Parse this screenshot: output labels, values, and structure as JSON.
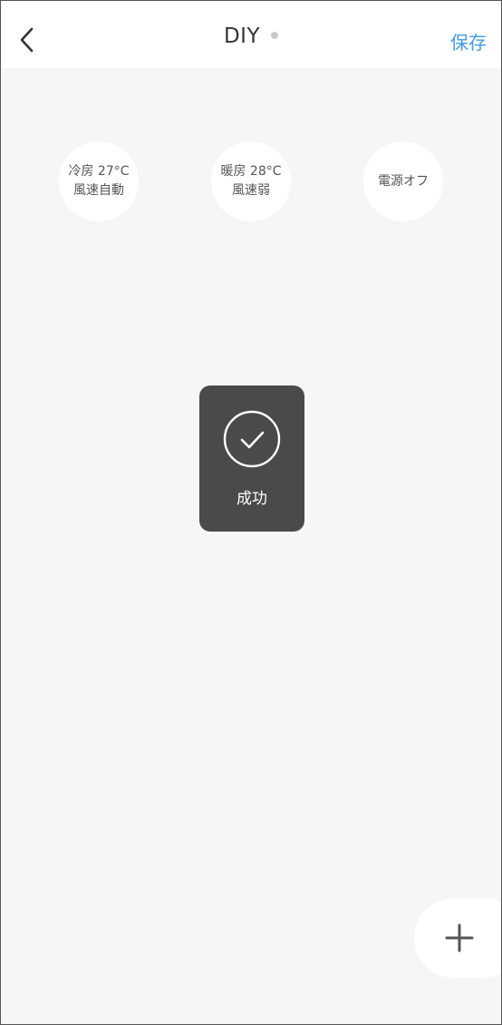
{
  "header": {
    "title": "DIY",
    "save_label": "保存"
  },
  "scenes": [
    {
      "line1": "冷房 27°C",
      "line2": "風速自動"
    },
    {
      "line1": "暖房 28°C",
      "line2": "風速弱"
    },
    {
      "line1": "電源オフ"
    }
  ],
  "toast": {
    "message": "成功",
    "icon": "check-circle-icon"
  },
  "icons": {
    "back": "chevron-left-icon",
    "status_dot": "status-dot",
    "add": "plus-icon"
  },
  "colors": {
    "accent": "#3d9be9",
    "background": "#f6f6f6",
    "toast_background": "#4a4a4a"
  }
}
